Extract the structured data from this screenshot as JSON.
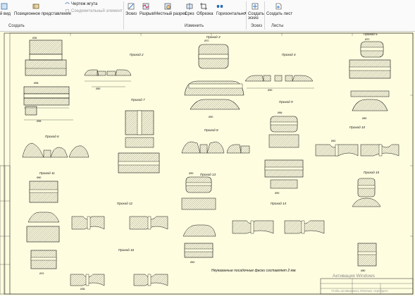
{
  "ribbon": {
    "partial_view_label": "й вид",
    "positional_view_label": "Позиционное представление",
    "harness_drawing_label": "Чертеж жгута",
    "connector_element_label": "Соединительный элемент",
    "sketch_label": "Эскиз",
    "break_label": "Разрыв",
    "local_section_label": "Местный разрез",
    "section_label": "Срез",
    "crop_label": "Обрезка",
    "horizontal_label": "Горизонтально",
    "create_sketch_label": "Создать эскиз",
    "create_sheet_label": "Создать лист",
    "groups": {
      "create": "Создать",
      "modify": "Изменить",
      "sketch": "Эскиз",
      "sheets": "Листы"
    }
  },
  "drawing": {
    "passes": [
      "Проход 2",
      "Проход 3",
      "Проход 4",
      "Проход 5",
      "Проход 6",
      "Проход 7",
      "Проход 8",
      "Проход 9",
      "Проход 10",
      "Проход 11",
      "Проход 12",
      "Проход 13",
      "Проход 14",
      "Проход 15",
      "Проход 16"
    ],
    "footnote": "Неуказанные посадочные фаски составляет 2 мм.",
    "watermark": "Активация Windows",
    "watermark_sub": "Чтобы активировать Windows, перейдите"
  },
  "colors": {
    "canvas": "#fefde0",
    "ribbon": "#fafafa",
    "ink": "#111111"
  }
}
